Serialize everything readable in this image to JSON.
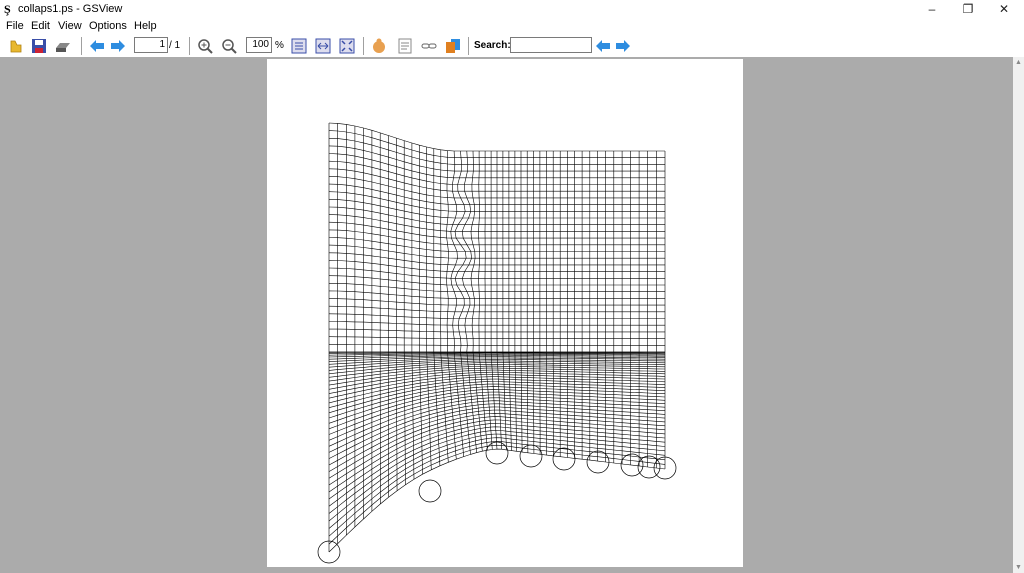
{
  "window": {
    "title": "collaps1.ps - GSView",
    "app_icon": "gsview-app-icon",
    "controls": {
      "minimize": "–",
      "restore": "❐",
      "close": "✕"
    }
  },
  "menu": [
    "File",
    "Edit",
    "View",
    "Options",
    "Help"
  ],
  "toolbar": {
    "page_current": "1",
    "page_total": "/ 1",
    "zoom_value": "100",
    "zoom_unit": "%",
    "search_label": "Search:",
    "search_value": "",
    "icons": [
      "open-file-icon",
      "save-icon",
      "print-icon",
      "prev-page-icon",
      "next-page-icon",
      "zoom-in-icon",
      "zoom-out-icon",
      "fit-page-icon",
      "fit-width-icon",
      "full-screen-icon",
      "info-icon",
      "text-extract-icon",
      "link-icon",
      "copy-icon",
      "search-prev-icon",
      "search-next-icon"
    ]
  },
  "colors": {
    "workspace": "#ababab",
    "page": "#ffffff",
    "arrow_blue": "#2e8de0",
    "mesh_line": "#000000"
  },
  "document": {
    "file": "collaps1.ps",
    "content": "finite-element mesh drawing"
  }
}
